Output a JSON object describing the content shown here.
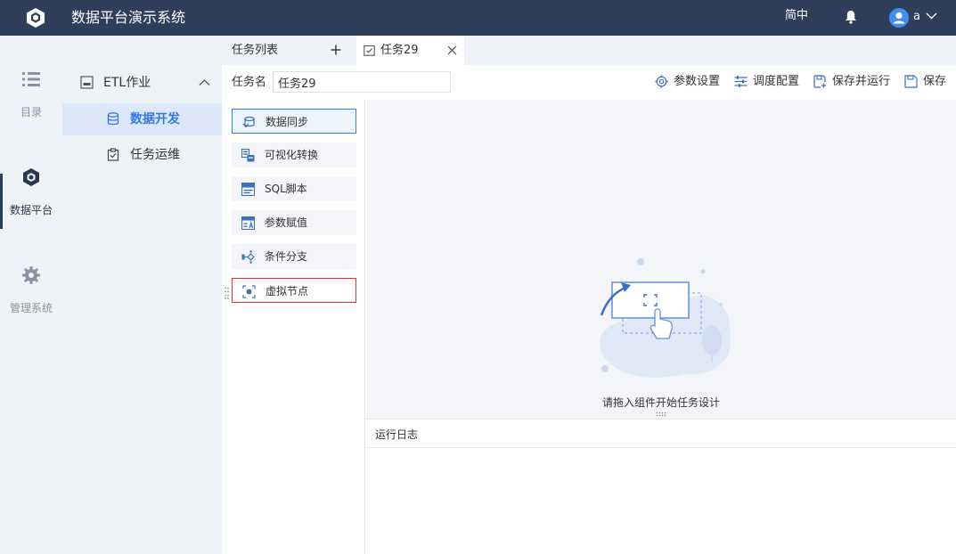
{
  "header": {
    "app_title": "数据平台演示系统",
    "lang_label": "简中",
    "user_name": "a"
  },
  "leftnav": {
    "items": [
      {
        "label": "目录",
        "icon": "list-icon",
        "active": false
      },
      {
        "label": "数据平台",
        "icon": "cube-icon",
        "active": true
      },
      {
        "label": "管理系统",
        "icon": "gear-icon",
        "active": false
      }
    ]
  },
  "submenu": {
    "group_label": "ETL作业",
    "items": [
      {
        "label": "数据开发",
        "icon": "database-icon",
        "active": true
      },
      {
        "label": "任务运维",
        "icon": "clipboard-icon",
        "active": false
      }
    ]
  },
  "tabs": {
    "list_label": "任务列表",
    "task_tab_label": "任务29"
  },
  "toolbar": {
    "task_name_label": "任务名",
    "task_name_value": "任务29",
    "buttons": [
      {
        "label": "参数设置",
        "icon": "gear-outline-icon"
      },
      {
        "label": "调度配置",
        "icon": "sliders-icon"
      },
      {
        "label": "保存并运行",
        "icon": "save-run-icon"
      },
      {
        "label": "保存",
        "icon": "save-icon"
      }
    ]
  },
  "components": [
    {
      "label": "数据同步",
      "icon": "data-sync-icon",
      "state": "selected"
    },
    {
      "label": "可视化转换",
      "icon": "visual-transform-icon",
      "state": "normal"
    },
    {
      "label": "SQL脚本",
      "icon": "sql-icon",
      "state": "normal"
    },
    {
      "label": "参数赋值",
      "icon": "param-assign-icon",
      "state": "normal"
    },
    {
      "label": "条件分支",
      "icon": "branch-icon",
      "state": "normal"
    },
    {
      "label": "虚拟节点",
      "icon": "virtual-node-icon",
      "state": "highlighted"
    }
  ],
  "canvas": {
    "hint": "请拖入组件开始任务设计"
  },
  "log": {
    "title": "运行日志"
  },
  "colors": {
    "header_bg": "#2f3e5a",
    "accent": "#3377e8",
    "highlight_border": "#e0312f"
  }
}
